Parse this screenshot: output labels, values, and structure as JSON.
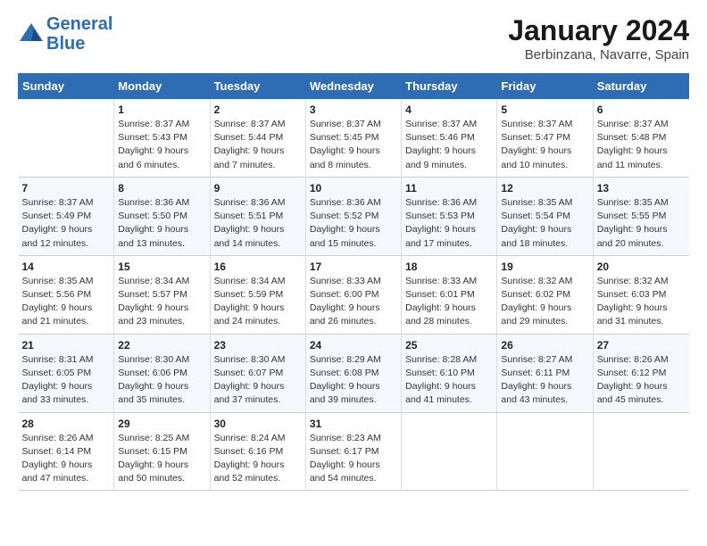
{
  "header": {
    "logo_line1": "General",
    "logo_line2": "Blue",
    "month": "January 2024",
    "location": "Berbinzana, Navarre, Spain"
  },
  "days_of_week": [
    "Sunday",
    "Monday",
    "Tuesday",
    "Wednesday",
    "Thursday",
    "Friday",
    "Saturday"
  ],
  "weeks": [
    [
      {
        "day": "",
        "text": ""
      },
      {
        "day": "1",
        "text": "Sunrise: 8:37 AM\nSunset: 5:43 PM\nDaylight: 9 hours\nand 6 minutes."
      },
      {
        "day": "2",
        "text": "Sunrise: 8:37 AM\nSunset: 5:44 PM\nDaylight: 9 hours\nand 7 minutes."
      },
      {
        "day": "3",
        "text": "Sunrise: 8:37 AM\nSunset: 5:45 PM\nDaylight: 9 hours\nand 8 minutes."
      },
      {
        "day": "4",
        "text": "Sunrise: 8:37 AM\nSunset: 5:46 PM\nDaylight: 9 hours\nand 9 minutes."
      },
      {
        "day": "5",
        "text": "Sunrise: 8:37 AM\nSunset: 5:47 PM\nDaylight: 9 hours\nand 10 minutes."
      },
      {
        "day": "6",
        "text": "Sunrise: 8:37 AM\nSunset: 5:48 PM\nDaylight: 9 hours\nand 11 minutes."
      }
    ],
    [
      {
        "day": "7",
        "text": "Sunrise: 8:37 AM\nSunset: 5:49 PM\nDaylight: 9 hours\nand 12 minutes."
      },
      {
        "day": "8",
        "text": "Sunrise: 8:36 AM\nSunset: 5:50 PM\nDaylight: 9 hours\nand 13 minutes."
      },
      {
        "day": "9",
        "text": "Sunrise: 8:36 AM\nSunset: 5:51 PM\nDaylight: 9 hours\nand 14 minutes."
      },
      {
        "day": "10",
        "text": "Sunrise: 8:36 AM\nSunset: 5:52 PM\nDaylight: 9 hours\nand 15 minutes."
      },
      {
        "day": "11",
        "text": "Sunrise: 8:36 AM\nSunset: 5:53 PM\nDaylight: 9 hours\nand 17 minutes."
      },
      {
        "day": "12",
        "text": "Sunrise: 8:35 AM\nSunset: 5:54 PM\nDaylight: 9 hours\nand 18 minutes."
      },
      {
        "day": "13",
        "text": "Sunrise: 8:35 AM\nSunset: 5:55 PM\nDaylight: 9 hours\nand 20 minutes."
      }
    ],
    [
      {
        "day": "14",
        "text": "Sunrise: 8:35 AM\nSunset: 5:56 PM\nDaylight: 9 hours\nand 21 minutes."
      },
      {
        "day": "15",
        "text": "Sunrise: 8:34 AM\nSunset: 5:57 PM\nDaylight: 9 hours\nand 23 minutes."
      },
      {
        "day": "16",
        "text": "Sunrise: 8:34 AM\nSunset: 5:59 PM\nDaylight: 9 hours\nand 24 minutes."
      },
      {
        "day": "17",
        "text": "Sunrise: 8:33 AM\nSunset: 6:00 PM\nDaylight: 9 hours\nand 26 minutes."
      },
      {
        "day": "18",
        "text": "Sunrise: 8:33 AM\nSunset: 6:01 PM\nDaylight: 9 hours\nand 28 minutes."
      },
      {
        "day": "19",
        "text": "Sunrise: 8:32 AM\nSunset: 6:02 PM\nDaylight: 9 hours\nand 29 minutes."
      },
      {
        "day": "20",
        "text": "Sunrise: 8:32 AM\nSunset: 6:03 PM\nDaylight: 9 hours\nand 31 minutes."
      }
    ],
    [
      {
        "day": "21",
        "text": "Sunrise: 8:31 AM\nSunset: 6:05 PM\nDaylight: 9 hours\nand 33 minutes."
      },
      {
        "day": "22",
        "text": "Sunrise: 8:30 AM\nSunset: 6:06 PM\nDaylight: 9 hours\nand 35 minutes."
      },
      {
        "day": "23",
        "text": "Sunrise: 8:30 AM\nSunset: 6:07 PM\nDaylight: 9 hours\nand 37 minutes."
      },
      {
        "day": "24",
        "text": "Sunrise: 8:29 AM\nSunset: 6:08 PM\nDaylight: 9 hours\nand 39 minutes."
      },
      {
        "day": "25",
        "text": "Sunrise: 8:28 AM\nSunset: 6:10 PM\nDaylight: 9 hours\nand 41 minutes."
      },
      {
        "day": "26",
        "text": "Sunrise: 8:27 AM\nSunset: 6:11 PM\nDaylight: 9 hours\nand 43 minutes."
      },
      {
        "day": "27",
        "text": "Sunrise: 8:26 AM\nSunset: 6:12 PM\nDaylight: 9 hours\nand 45 minutes."
      }
    ],
    [
      {
        "day": "28",
        "text": "Sunrise: 8:26 AM\nSunset: 6:14 PM\nDaylight: 9 hours\nand 47 minutes."
      },
      {
        "day": "29",
        "text": "Sunrise: 8:25 AM\nSunset: 6:15 PM\nDaylight: 9 hours\nand 50 minutes."
      },
      {
        "day": "30",
        "text": "Sunrise: 8:24 AM\nSunset: 6:16 PM\nDaylight: 9 hours\nand 52 minutes."
      },
      {
        "day": "31",
        "text": "Sunrise: 8:23 AM\nSunset: 6:17 PM\nDaylight: 9 hours\nand 54 minutes."
      },
      {
        "day": "",
        "text": ""
      },
      {
        "day": "",
        "text": ""
      },
      {
        "day": "",
        "text": ""
      }
    ]
  ]
}
